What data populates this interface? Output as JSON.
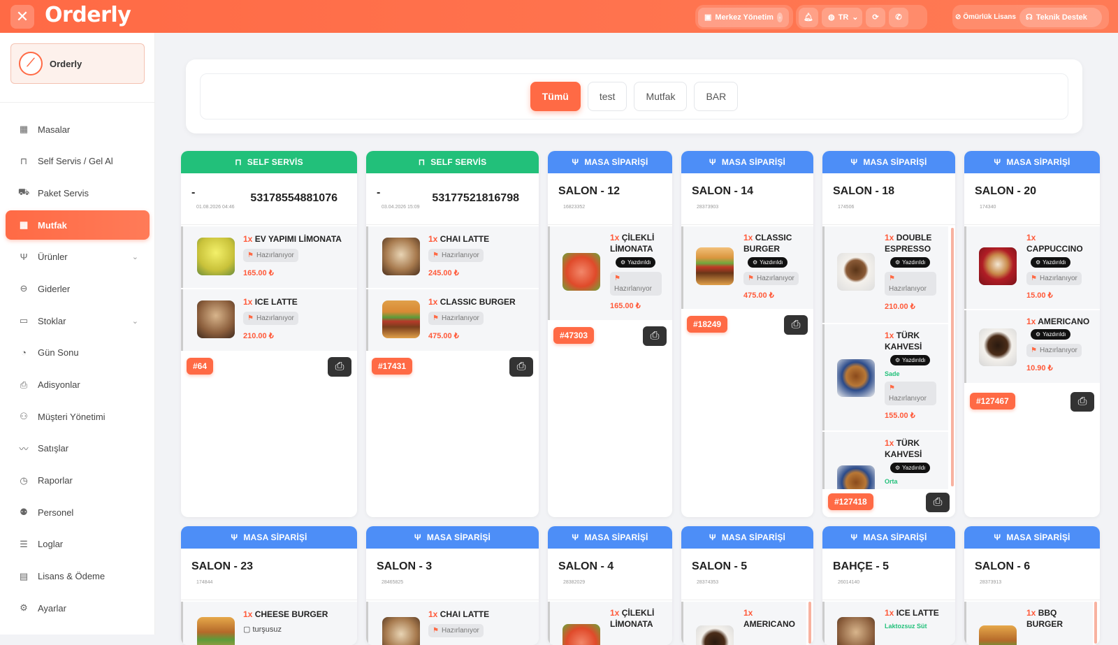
{
  "app": {
    "title": "Orderly",
    "close_icon": "close-icon"
  },
  "topbar": {
    "merkez": "Merkez Yönetim",
    "language": "TR",
    "license": "Ömürlük Lisans",
    "support": "Teknik Destek"
  },
  "sidebar": {
    "logo_text": "Orderly",
    "items": [
      {
        "label": "Masalar",
        "icon": "grid-icon"
      },
      {
        "label": "Self Servis / Gel Al",
        "icon": "bag-icon"
      },
      {
        "label": "Paket Servis",
        "icon": "truck-icon"
      },
      {
        "label": "Mutfak",
        "icon": "grid-icon"
      },
      {
        "label": "Ürünler",
        "icon": "fork-knife-icon"
      },
      {
        "label": "Giderler",
        "icon": "minus-circle-icon"
      },
      {
        "label": "Stoklar",
        "icon": "box-icon"
      },
      {
        "label": "Gün Sonu",
        "icon": "moon-clock-icon"
      },
      {
        "label": "Adisyonlar",
        "icon": "printer-icon"
      },
      {
        "label": "Müşteri Yönetimi",
        "icon": "users-icon"
      },
      {
        "label": "Satışlar",
        "icon": "trend-icon"
      },
      {
        "label": "Raporlar",
        "icon": "pie-chart-icon"
      },
      {
        "label": "Personel",
        "icon": "team-icon"
      },
      {
        "label": "Loglar",
        "icon": "list-icon"
      },
      {
        "label": "Lisans & Ödeme",
        "icon": "card-icon"
      },
      {
        "label": "Ayarlar",
        "icon": "gear-icon"
      }
    ]
  },
  "filters": [
    "Tümü",
    "test",
    "Mutfak",
    "BAR"
  ],
  "labels": {
    "self_servis": "SELF SERVİS",
    "masa_siparisi": "MASA SİPARİŞİ",
    "hazirlaniyor": "Hazırlanıyor",
    "yazdirildi": "Yazdırıldı"
  },
  "cards_row1": [
    {
      "type": "self",
      "dash": "-",
      "date": "01.08.2026 04:46",
      "number": "53178554881076",
      "items": [
        {
          "qty": "1x",
          "name": "EV YAPIMI LİMONATA",
          "price": "165.00 ₺"
        },
        {
          "qty": "1x",
          "name": "ICE LATTE",
          "price": "210.00 ₺"
        }
      ],
      "order": "#64"
    },
    {
      "type": "self",
      "dash": "-",
      "date": "03.04.2026 15:09",
      "number": "53177521816798",
      "items": [
        {
          "qty": "1x",
          "name": "CHAI LATTE",
          "price": "245.00 ₺"
        },
        {
          "qty": "1x",
          "name": "CLASSIC BURGER",
          "price": "475.00 ₺"
        }
      ],
      "order": "#17431"
    },
    {
      "type": "masa",
      "title": "SALON - 12",
      "sub": "16823352",
      "items": [
        {
          "qty": "1x",
          "name": "ÇİLEKLİ LİMONATA",
          "price": "165.00 ₺"
        }
      ],
      "order": "#47303"
    },
    {
      "type": "masa",
      "title": "SALON - 14",
      "sub": "28373903",
      "items": [
        {
          "qty": "1x",
          "name": "CLASSIC BURGER",
          "price": "475.00 ₺"
        }
      ],
      "order": "#18249"
    },
    {
      "type": "masa",
      "title": "SALON - 18",
      "sub": "174506",
      "items": [
        {
          "qty": "1x",
          "name": "DOUBLE ESPRESSO",
          "price": "210.00 ₺"
        },
        {
          "qty": "1x",
          "name": "TÜRK KAHVESİ",
          "note": "Sade",
          "price": "155.00 ₺"
        },
        {
          "qty": "1x",
          "name": "TÜRK KAHVESİ",
          "note": "Orta"
        }
      ],
      "order": "#127418"
    },
    {
      "type": "masa",
      "title": "SALON - 20",
      "sub": "174340",
      "items": [
        {
          "qty": "1x",
          "name": "CAPPUCCINO",
          "price": "15.00 ₺"
        },
        {
          "qty": "1x",
          "name": "AMERICANO",
          "price": "10.90 ₺"
        }
      ],
      "order": "#127467"
    }
  ],
  "cards_row2": [
    {
      "title": "SALON - 23",
      "sub": "174844",
      "first_item": {
        "qty": "1x",
        "name": "CHEESE BURGER",
        "note": "turşusuz"
      }
    },
    {
      "title": "SALON - 3",
      "sub": "28465825",
      "first_item": {
        "qty": "1x",
        "name": "CHAI LATTE"
      }
    },
    {
      "title": "SALON - 4",
      "sub": "28382029",
      "first_item": {
        "qty": "1x",
        "name": "ÇİLEKLİ LİMONATA"
      }
    },
    {
      "title": "SALON - 5",
      "sub": "28374353",
      "first_item": {
        "qty": "1x",
        "name": "AMERICANO"
      }
    },
    {
      "title": "BAHÇE - 5",
      "sub": "26014140",
      "first_item": {
        "qty": "1x",
        "name": "ICE LATTE",
        "note": "Laktozsuz Süt"
      }
    },
    {
      "title": "SALON - 6",
      "sub": "28373913",
      "first_item": {
        "qty": "1x",
        "name": "BBQ BURGER"
      }
    }
  ],
  "colors": {
    "accent": "#ff6a45",
    "green": "#22c07a",
    "blue": "#4d8ef7"
  }
}
